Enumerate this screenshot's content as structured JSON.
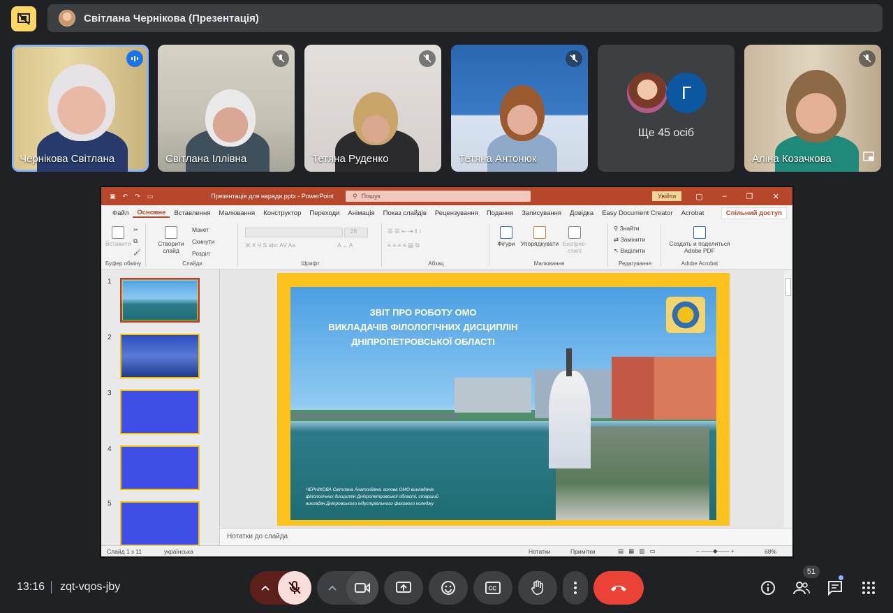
{
  "presenter_bar": {
    "name": "Світлана Чернікова (Презентація)"
  },
  "tiles": [
    {
      "name": "Чернікова Світлана",
      "muted": false
    },
    {
      "name": "Світлана Іллівна",
      "muted": true
    },
    {
      "name": "Тетяна Руденко",
      "muted": true
    },
    {
      "name": "Тетяна Антонюк",
      "muted": true
    },
    {
      "more_label": "Ще 45 осіб",
      "avatar_letter": "Г"
    },
    {
      "name": "Аліна Козачкова",
      "muted": true
    }
  ],
  "ppt": {
    "file_title": "Презентація для наради.pptx  -  PowerPoint",
    "search_placeholder": "Пошук",
    "signin": "Увійти",
    "menu": [
      "Файл",
      "Основне",
      "Вставлення",
      "Малювання",
      "Конструктор",
      "Переходи",
      "Анімація",
      "Показ слайдів",
      "Рецензування",
      "Подання",
      "Записування",
      "Довідка",
      "Easy Document Creator",
      "Acrobat"
    ],
    "active_menu": "Основне",
    "share": "Спільний доступ",
    "ribbon": {
      "paste": "Вставити",
      "clipboard": "Буфер обміну",
      "new_slide": "Створити слайд",
      "layout": "Макет",
      "reset": "Скинути",
      "section": "Розділ",
      "slides": "Слайди",
      "font": "Шрифт",
      "font_size": "28",
      "paragraph": "Абзац",
      "shapes": "Фігури",
      "arrange": "Упорядкувати",
      "quick_styles": "Експрес-стилі",
      "drawing": "Малювання",
      "find": "Знайти",
      "replace": "Замінити",
      "select": "Виділити",
      "editing": "Редагування",
      "create_pdf": "Создать и поделиться Adobe PDF",
      "acrobat": "Adobe Acrobat"
    },
    "thumb_numbers": [
      "1",
      "2",
      "3",
      "4",
      "5"
    ],
    "slide": {
      "title_lines": [
        "ЗВІТ ПРО РОБОТУ ОМО",
        "ВИКЛАДАЧІВ  ФІЛОЛОГІЧНИХ ДИСЦИПЛІН",
        "ДНІПРОПЕТРОВСЬКОЇ ОБЛАСТІ"
      ],
      "subtitle_lines": [
        "ЧЕРНІКОВА Світлана Анатоліївна, голова ОМО викладачів",
        "філологічних дисциплін Дніпропетровської області, старший",
        "викладач Дніпровського індустріального фахового коледжу"
      ]
    },
    "notes": "Нотатки до слайда",
    "status": {
      "slide_counter": "Слайд 1 з 11",
      "language": "українська",
      "notes_btn": "Нотатки",
      "comments_btn": "Примітки",
      "zoom": "68%"
    }
  },
  "bottom": {
    "time": "13:16",
    "meeting_code": "zqt-vqos-jby",
    "people_count": "51"
  },
  "colors": {
    "meet_bg": "#202124",
    "tile_bg": "#3c4043",
    "accent_blue": "#8ab4f8",
    "end_call": "#ea4335",
    "ppt_red": "#b7472a",
    "slide_frame": "#fdc21b",
    "mic_off_bg": "#f9dedc"
  }
}
